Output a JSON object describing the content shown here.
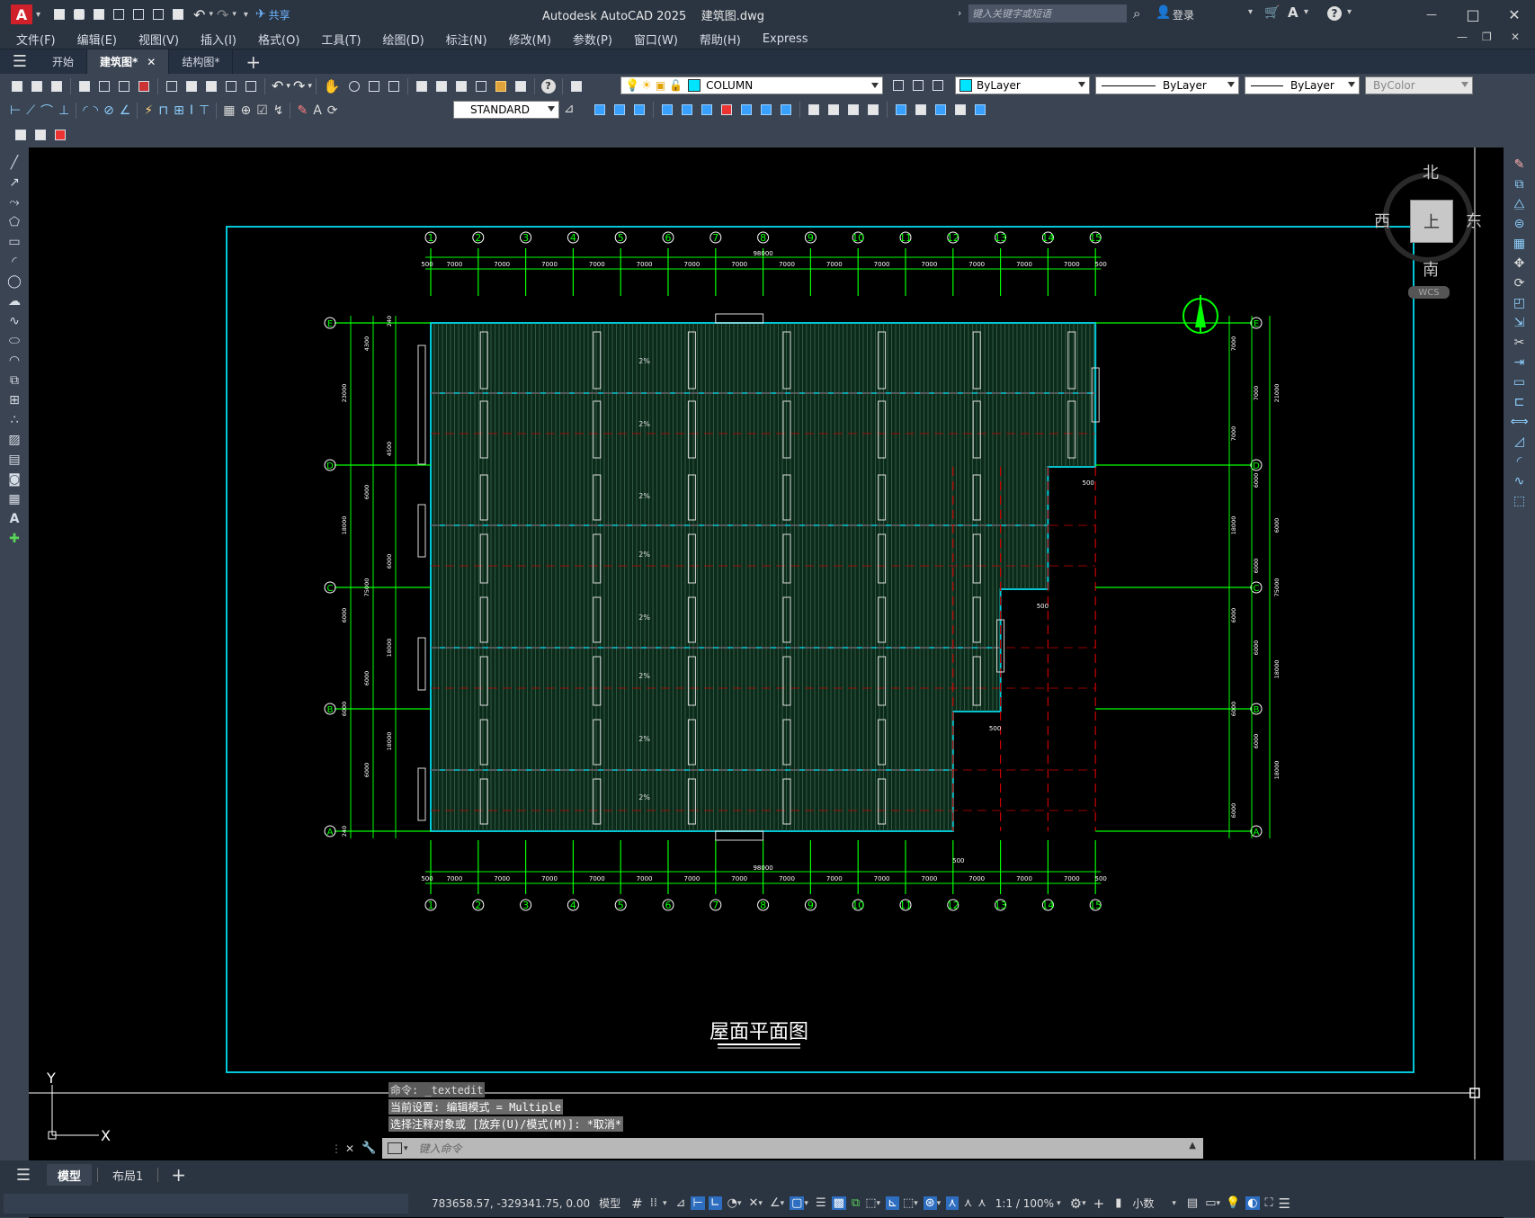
{
  "app": {
    "logo_letter": "A",
    "share_label": "共享",
    "window_title": "Autodesk AutoCAD 2025    建筑图.dwg",
    "search_placeholder": "键入关键字或短语",
    "login_label": "登录",
    "help_label": "?",
    "controls": {
      "minimize": "—",
      "maximize": "□",
      "close": "✕"
    }
  },
  "menu": {
    "items": [
      "文件(F)",
      "编辑(E)",
      "视图(V)",
      "插入(I)",
      "格式(O)",
      "工具(T)",
      "绘图(D)",
      "标注(N)",
      "修改(M)",
      "参数(P)",
      "窗口(W)",
      "帮助(H)",
      "Express"
    ]
  },
  "tabs": {
    "items": [
      "开始",
      "建筑图*",
      "结构图*"
    ],
    "active_index": 1,
    "close_glyph": "✕",
    "add_glyph": "+"
  },
  "toolbar": {
    "layer_name": "COLUMN",
    "color": "ByLayer",
    "linetype": "ByLayer",
    "lineweight": "ByLayer",
    "plotstyle": "ByColor",
    "text_style": "STANDARD"
  },
  "viewcube": {
    "north": "北",
    "south": "南",
    "east": "东",
    "west": "西",
    "face": "上",
    "wcs": "WCS"
  },
  "drawing": {
    "title": "屋面平面图",
    "grid_numbers": [
      "1",
      "2",
      "3",
      "4",
      "5",
      "6",
      "7",
      "8",
      "9",
      "10",
      "11",
      "12",
      "13",
      "14",
      "15"
    ],
    "grid_letters": [
      "E",
      "D",
      "C",
      "B",
      "A"
    ],
    "bay_dims": [
      "7000",
      "7000",
      "7000",
      "7000",
      "7000",
      "7000",
      "7000",
      "7000",
      "7000",
      "7000",
      "7000",
      "7000",
      "7000",
      "7000"
    ],
    "edge_dim": "500",
    "total_dim": "98000",
    "left_dims": [
      "240",
      "4300",
      "23000",
      "4500",
      "6000",
      "18000",
      "6000",
      "75000",
      "6000",
      "18000",
      "6000",
      "6000",
      "18000",
      "6000",
      "240"
    ],
    "right_dims": [
      "7000",
      "7000",
      "21000",
      "7000",
      "6000",
      "6000",
      "18000",
      "6000",
      "75000",
      "6000",
      "6000",
      "18000",
      "6000",
      "6000",
      "18000",
      "6000"
    ],
    "slope_label": "2%",
    "inner_dims": [
      "500",
      "500",
      "500"
    ],
    "ucs_x": "X",
    "ucs_y": "Y"
  },
  "command": {
    "history": [
      "命令: _textedit",
      "当前设置: 编辑模式 = Multiple",
      "选择注释对象或 [放弃(U)/模式(M)]: *取消*"
    ],
    "placeholder": "键入命令"
  },
  "layouts": {
    "items": [
      "模型",
      "布局1"
    ],
    "active_index": 0,
    "add_glyph": "+"
  },
  "status": {
    "coordinates": "783658.57, -329341.75, 0.00",
    "mode": "模型",
    "scale": "1:1 / 100%",
    "units": "小数"
  },
  "colors": {
    "grid_green": "#00ff00",
    "cyan": "#00c8d8",
    "red_dash": "#cc0000",
    "titlebar": "#2b3542",
    "toolbar": "#3a4452"
  }
}
